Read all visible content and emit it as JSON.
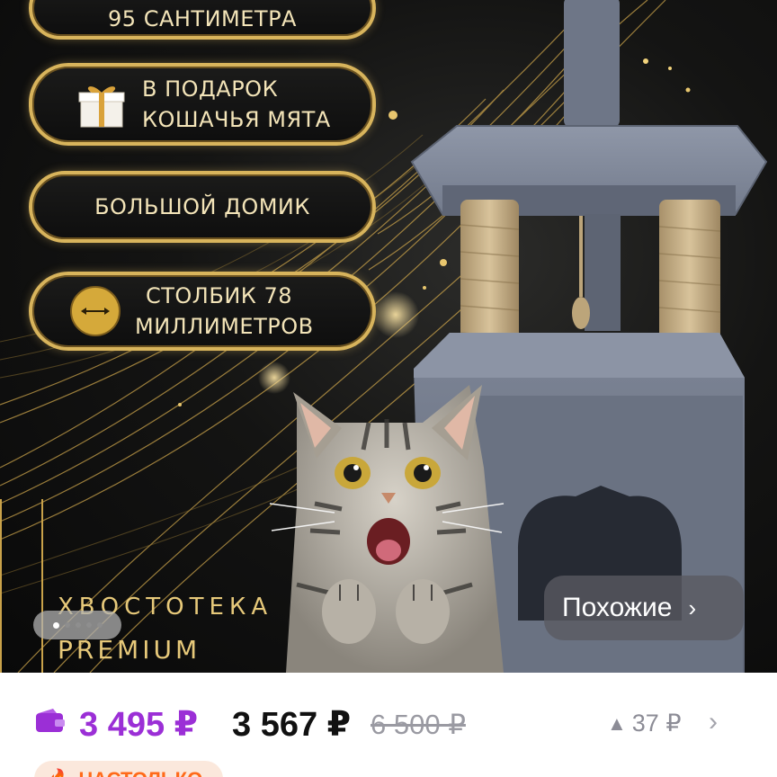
{
  "features": {
    "height_label": "95 САНТИМЕТРА",
    "gift_line1": "В ПОДАРОК",
    "gift_line2": "КОШАЧЬЯ МЯТА",
    "house_label": "БОЛЬШОЙ ДОМИК",
    "post_line1": "СТОЛБИК 78",
    "post_line2": "МИЛЛИМЕТРОВ"
  },
  "brand": {
    "name": "ХВОСТОТЕКА",
    "tier": "PREMIUM"
  },
  "gallery": {
    "dot_count": 5,
    "active_index": 0,
    "similar_label": "Похожие",
    "similar_chevron": "›"
  },
  "price": {
    "wallet_price": "3 495 ₽",
    "regular_price": "3 567 ₽",
    "old_price": "6 500 ₽",
    "change_value": "37 ₽",
    "change_arrow": "▲",
    "more_chevron": "›"
  },
  "badge": {
    "icon": "fire-icon",
    "label": "НАСТОЛЬКО"
  },
  "colors": {
    "accent_purple": "#9b2fd6",
    "gold": "#d8b45c",
    "badge_orange": "#ff6a1a"
  }
}
